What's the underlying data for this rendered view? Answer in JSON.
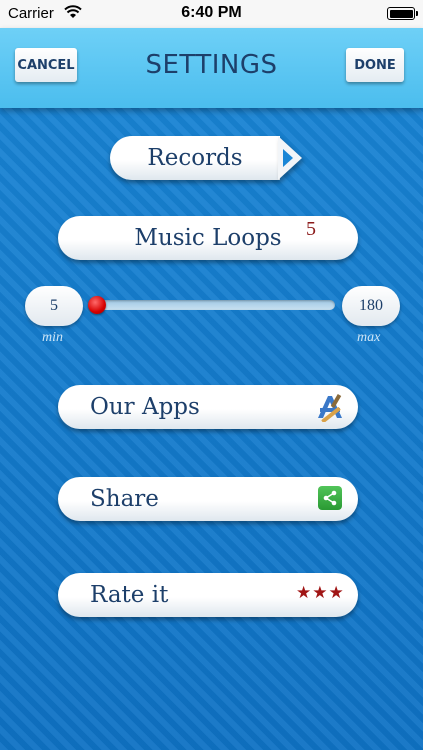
{
  "status_bar": {
    "carrier": "Carrier",
    "time": "6:40 PM"
  },
  "nav": {
    "title": "SETTINGS",
    "cancel_label": "CANCEL",
    "done_label": "DONE"
  },
  "records": {
    "label": "Records"
  },
  "music_loops": {
    "label": "Music Loops",
    "count": "5",
    "min_value": "5",
    "max_value": "180",
    "min_label": "min",
    "max_label": "max",
    "slider_position": 0
  },
  "menu": {
    "our_apps": {
      "label": "Our Apps",
      "icon": "app-store-icon"
    },
    "share": {
      "label": "Share",
      "icon": "share-icon"
    },
    "rate": {
      "label": "Rate it",
      "stars": "★★★",
      "star_color": "#a01515"
    }
  },
  "colors": {
    "background": "#1a86d6",
    "navbar": "#5cc6f2",
    "text": "#1d3f6a",
    "accent_red": "#d60000"
  }
}
